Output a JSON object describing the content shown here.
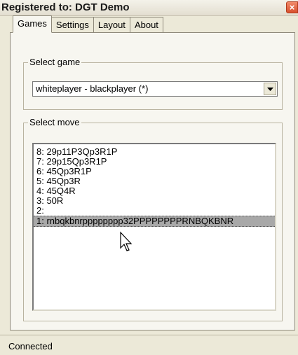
{
  "window": {
    "title": "Registered to: DGT Demo",
    "close_label": "×"
  },
  "tabs": [
    {
      "label": "Games",
      "active": true
    },
    {
      "label": "Settings",
      "active": false
    },
    {
      "label": "Layout",
      "active": false
    },
    {
      "label": "About",
      "active": false
    }
  ],
  "select_game": {
    "label": "Select game",
    "value": "whiteplayer - blackplayer (*)"
  },
  "select_move": {
    "label": "Select move",
    "items": [
      {
        "text": "8:  29p11P3Qp3R1P",
        "selected": false
      },
      {
        "text": "7:  29p15Qp3R1P",
        "selected": false
      },
      {
        "text": "6:  45Qp3R1P",
        "selected": false
      },
      {
        "text": "5:  45Qp3R",
        "selected": false
      },
      {
        "text": "4:  45Q4R",
        "selected": false
      },
      {
        "text": "3:  50R",
        "selected": false
      },
      {
        "text": "2:",
        "selected": false
      },
      {
        "text": "1:  rnbqkbnrpppppppp32PPPPPPPPRNBQKBNR",
        "selected": true
      }
    ]
  },
  "status": {
    "text": "Connected"
  },
  "colors": {
    "window_bg": "#ece9d8",
    "panel_bg": "#f7f6f0",
    "selection": "#a8a8a8",
    "close_button": "#d8502e"
  },
  "icons": {
    "close": "close-icon",
    "dropdown": "chevron-down-icon",
    "pointer": "mouse-pointer-icon"
  }
}
